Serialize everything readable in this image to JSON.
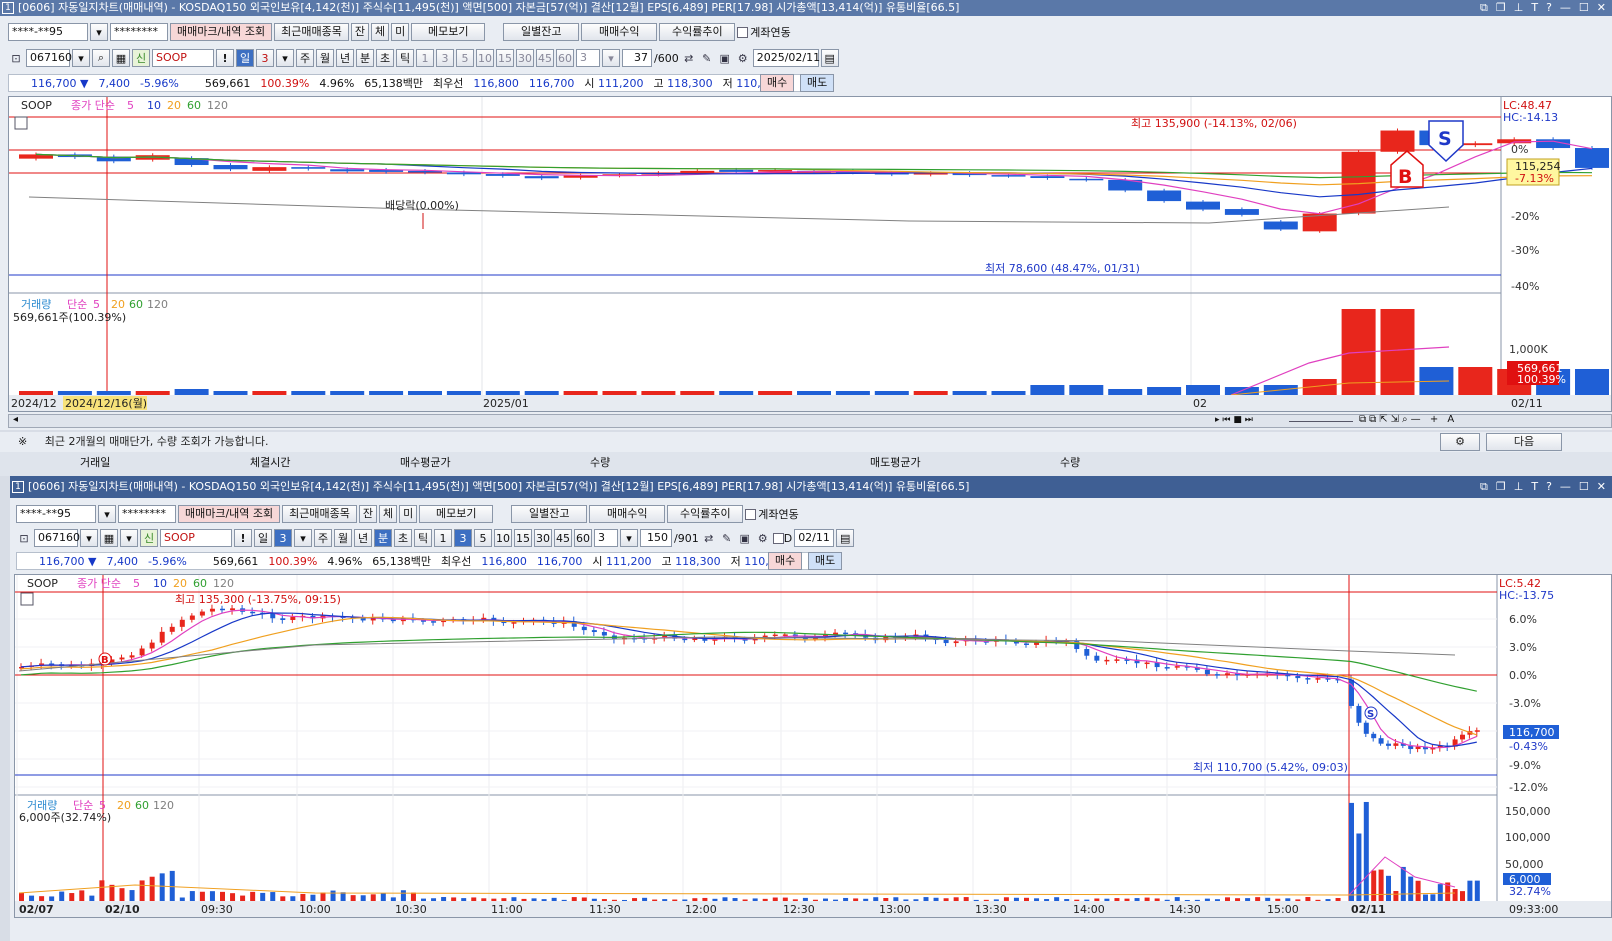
{
  "w1": {
    "title": "[0606] 자동일지차트(매매내역) - KOSDAQ150 외국인보유[4,142(천)] 주식수[11,495(천)] 액면[500] 자본금[57(억)] 결산[12월] EPS[6,489] PER[17.98] 시가총액[13,414(억)] 유통비율[66.5]",
    "window_num": "1",
    "account": "****-**95",
    "password": "********",
    "btn_marks": "매매마크/내역 조회",
    "btn_recent": "최근매매종목",
    "btn_jan": "잔",
    "btn_che": "체",
    "btn_mi": "미",
    "btn_memo": "메모보기",
    "btn_daily": "일별잔고",
    "btn_profit": "매매수익",
    "btn_trend": "수익률추이",
    "link_label": "계좌연동",
    "code": "067160",
    "new_tag": "신",
    "name": "SOOP",
    "period_day": "일",
    "period_n": "3",
    "periods": [
      "주",
      "월",
      "년",
      "분",
      "초",
      "틱"
    ],
    "mins": [
      "1",
      "3",
      "5",
      "10",
      "15",
      "30",
      "45",
      "60"
    ],
    "n_value": "3",
    "count": "37",
    "count_total": "/600",
    "date": "2025/02/11",
    "price": "116,700 ▼",
    "change": "7,400",
    "change_pct": "-5.96%",
    "volume": "569,661",
    "vol_ratio": "100.39%",
    "turnover": "4.96%",
    "amount": "65,138백만",
    "best_label": "최우선",
    "ask": "116,800",
    "bid": "116,700",
    "open_label": "시",
    "open": "111,200",
    "high_label": "고",
    "high": "118,300",
    "low_label": "저",
    "low": "110,700",
    "buy": "매수",
    "sell": "매도",
    "legend_name": "SOOP",
    "legend_ma": "종가 단순",
    "ma": [
      "5",
      "10",
      "20",
      "60",
      "120"
    ],
    "lc": "LC:48.47",
    "hc": "HC:-14.13",
    "hi_label": "최고 135,900 (-14.13%, 02/06)",
    "lo_label": "최저 78,600 (48.47%, 01/31)",
    "div_label": "배당락(0.00%)",
    "cur_price_tag": "115,254",
    "cur_pct_tag": "-7.13%",
    "y_ticks": [
      "0%",
      "-10%",
      "-20%",
      "-30%",
      "-40%"
    ],
    "vol_legend": "거래량",
    "vol_ma_label": "단순",
    "vol_ma": [
      "5",
      "20",
      "60",
      "120"
    ],
    "vol_value": "569,661주(100.39%)",
    "vol_ticks": [
      "1,000K"
    ],
    "vol_tag": "569,661",
    "vol_tag_pct": "100.39%",
    "x_labels": [
      "2024/12",
      "2025/01",
      "02"
    ],
    "x_sel": "2024/12/16(월)",
    "x_right": "02/11",
    "marker_b": "B",
    "marker_s": "S"
  },
  "note": {
    "mark": "※",
    "text": "최근 2개월의 매매단가, 수량 조회가 가능합니다.",
    "next": "다음",
    "headers": [
      "거래일",
      "체결시간",
      "매수평균가",
      "수량",
      "매도평균가",
      "수량"
    ]
  },
  "w2": {
    "title": "[0606] 자동일지차트(매매내역) - KOSDAQ150 외국인보유[4,142(천)] 주식수[11,495(천)] 액면[500] 자본금[57(억)] 결산[12월] EPS[6,489] PER[17.98] 시가총액[13,414(억)] 유통비율[66.5]",
    "window_num": "1",
    "account": "****-**95",
    "password": "********",
    "code": "067160",
    "name": "SOOP",
    "period_day": "일",
    "period_n": "3",
    "n_value": "3",
    "count": "150",
    "count_total": "/901",
    "date_d": "D",
    "date": "02/11",
    "legend_name": "SOOP",
    "lc": "LC:5.42",
    "hc": "HC:-13.75",
    "hi_label": "최고 135,300 (-13.75%, 09:15)",
    "lo_label": "최저 110,700 (5.42%, 09:03)",
    "y_ticks": [
      "6.0%",
      "3.0%",
      "0.0%",
      "-3.0%",
      "-6.0%",
      "-9.0%",
      "-12.0%"
    ],
    "cur_price_tag": "116,700",
    "cur_pct_tag": "-0.43%",
    "vol_value": "6,000주(32.74%)",
    "vol_ticks": [
      "150,000",
      "100,000",
      "50,000"
    ],
    "vol_tag": "6,000",
    "vol_tag_pct": "32.74%",
    "x_labels": [
      "02/07",
      "02/10",
      "09:30",
      "10:00",
      "10:30",
      "11:00",
      "11:30",
      "12:00",
      "12:30",
      "13:00",
      "13:30",
      "14:00",
      "14:30",
      "15:00",
      "02/11"
    ],
    "x_right": "09:33:00"
  },
  "colors": {
    "up": "#e8261c",
    "down": "#1f5fd6",
    "ma5": "#e040c0",
    "ma10": "#1838c8",
    "ma20": "#f0a020",
    "ma60": "#30a030",
    "ma120": "#808080"
  },
  "chart_data": [
    {
      "type": "candlestick",
      "title": "SOOP 일봉",
      "x_range": [
        "2024/12",
        "2025/02/11"
      ],
      "annotations": {
        "high": 135900,
        "low": 78600
      },
      "last": {
        "open": 111200,
        "high": 118300,
        "low": 110700,
        "close": 116700
      }
    },
    {
      "type": "candlestick",
      "title": "SOOP 3분봉",
      "annotations": {
        "high": 135300,
        "low": 110700
      },
      "last": {
        "close": 116700
      }
    }
  ]
}
